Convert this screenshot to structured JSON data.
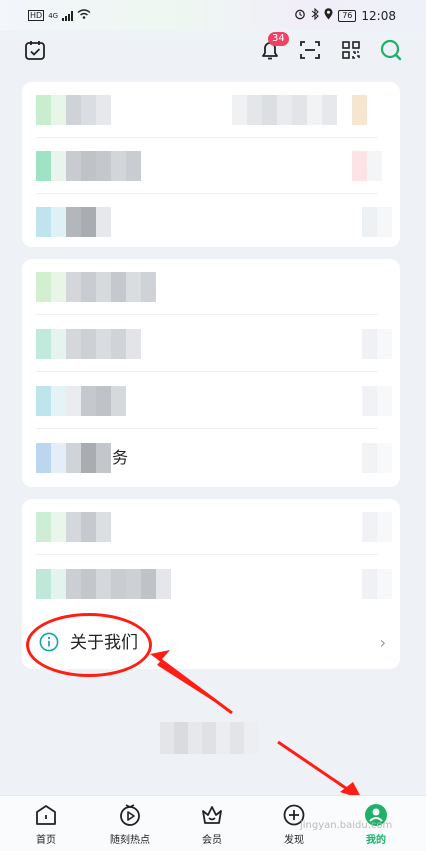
{
  "status_bar": {
    "left_indicators": [
      "HD",
      "4G"
    ],
    "battery": "76",
    "time": "12:08"
  },
  "header": {
    "notification_count": "34",
    "icons": [
      "calendar-check-icon",
      "bell-icon",
      "scan-icon",
      "qr-code-icon",
      "search-icon"
    ]
  },
  "menu": {
    "about_label": "关于我们"
  },
  "partial_text": "务",
  "tabs": [
    {
      "label": "首页",
      "icon": "home-icon"
    },
    {
      "label": "随刻热点",
      "icon": "hot-play-icon"
    },
    {
      "label": "会员",
      "icon": "vip-crown-icon"
    },
    {
      "label": "发现",
      "icon": "discover-plus-icon"
    },
    {
      "label": "我的",
      "icon": "profile-icon",
      "active": true
    }
  ],
  "watermark": "jingyan.baidu.com",
  "colors": {
    "brand_green": "#1fb16a",
    "badge_red": "#f24063",
    "annotation_red": "#ff1d14",
    "info_teal": "#15a4a8"
  }
}
